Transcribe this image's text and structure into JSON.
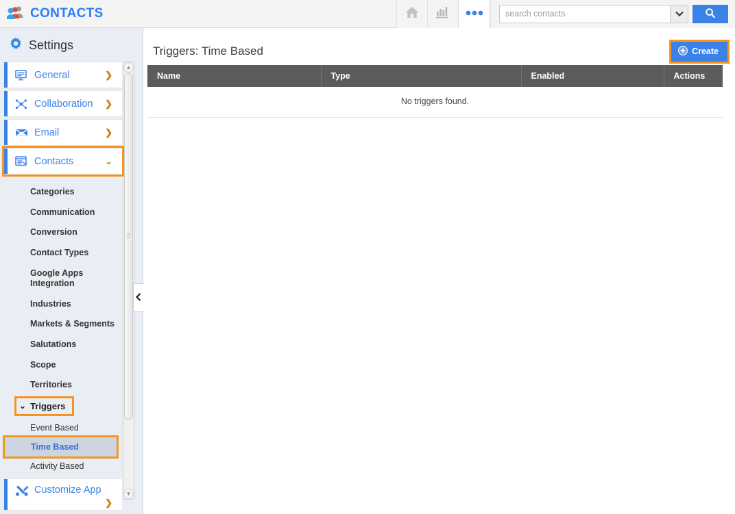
{
  "topbar": {
    "app_title": "CONTACTS",
    "logo_icon": "people-group-icon",
    "home_icon": "home-icon",
    "reports_icon": "bar-chart-icon",
    "more_icon": "ellipsis-icon",
    "search": {
      "placeholder": "search contacts",
      "value": "",
      "dropdown_icon": "chevron-down-icon",
      "search_icon": "magnifier-icon"
    }
  },
  "sidebar": {
    "header": {
      "title": "Settings",
      "icon": "gear-icon"
    },
    "top_items": [
      {
        "label": "General",
        "icon": "monitor-icon",
        "chevron": "❯",
        "selected": false
      },
      {
        "label": "Collaboration",
        "icon": "network-icon",
        "chevron": "❯",
        "selected": false
      },
      {
        "label": "Email",
        "icon": "envelope-icon",
        "chevron": "❯",
        "selected": false
      },
      {
        "label": "Contacts",
        "icon": "window-icon",
        "chevron": "⌄",
        "selected": true
      }
    ],
    "sub_items": [
      "Categories",
      "Communication",
      "Conversion",
      "Contact Types",
      "Google Apps Integration",
      "Industries",
      "Markets & Segments",
      "Salutations",
      "Scope",
      "Territories"
    ],
    "trigger_group": {
      "label": "Triggers",
      "chevron": "⌄",
      "highlighted": true,
      "children": [
        {
          "label": "Event Based",
          "active": false
        },
        {
          "label": "Time Based",
          "active": true
        },
        {
          "label": "Activity Based",
          "active": false
        }
      ]
    },
    "bottom_item": {
      "label": "Customize App",
      "icon": "tools-icon",
      "chevron": "❯"
    },
    "scrollbar": {
      "up_arrow": "▲",
      "down_arrow": "▼"
    },
    "collapse_handle_icon": "chevron-left-icon"
  },
  "main": {
    "page_title": "Triggers: Time Based",
    "create_label": "Create",
    "create_icon": "plus-circle-icon",
    "table": {
      "columns": [
        "Name",
        "Type",
        "Enabled",
        "Actions"
      ],
      "rows": [],
      "empty_message": "No triggers found."
    }
  },
  "colors": {
    "accent_blue": "#3b82e8",
    "highlight_orange": "#f7941e",
    "table_header_gray": "#5e5c5a",
    "sidebar_bg": "#e9eef5"
  }
}
